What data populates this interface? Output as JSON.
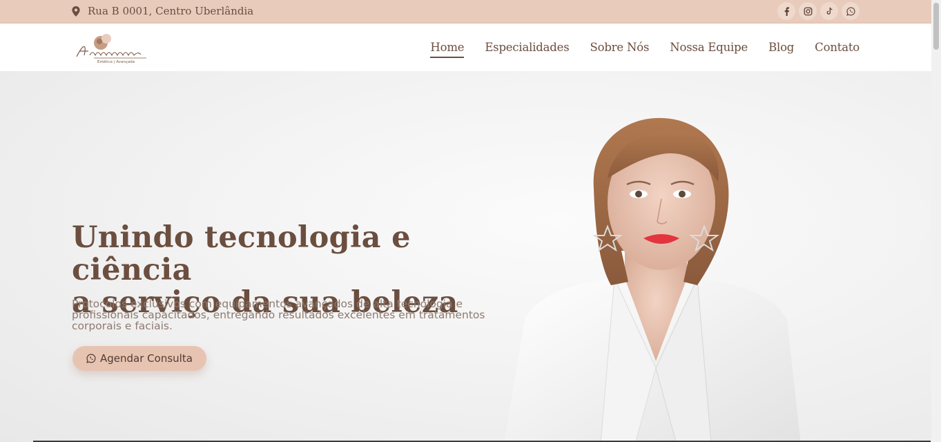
{
  "topbar": {
    "address": "Rua B 0001, Centro Uberlândia",
    "address_icon": "map-marker-icon",
    "socials": [
      {
        "name": "facebook-icon"
      },
      {
        "name": "instagram-icon"
      },
      {
        "name": "tiktok-icon"
      },
      {
        "name": "whatsapp-icon"
      }
    ]
  },
  "logo": {
    "name": "Anastasia",
    "tagline_left": "Estética",
    "tagline_right": "Avançada"
  },
  "nav": {
    "items": [
      "Home",
      "Especialidades",
      "Sobre Nós",
      "Nossa Equipe",
      "Blog",
      "Contato"
    ],
    "active": "Home"
  },
  "hero": {
    "headline_line1": "Unindo tecnologia e ciência",
    "headline_line2_prefix": "a serviço da ",
    "headline_line2_bold": "sua beleza",
    "subtext": "Protocolos exclusivos com equipamentos avançados de alta tecnologia e profissionais capacitados, entregando resultados excelentes em tratamentos corporais e faciais.",
    "cta_label": "Agendar Consulta",
    "cta_icon": "whatsapp-icon"
  },
  "colors": {
    "topbar_bg": "#e8cbbb",
    "brand_brown": "#6b4e3f",
    "cta_bg": "#e7c4b2"
  }
}
